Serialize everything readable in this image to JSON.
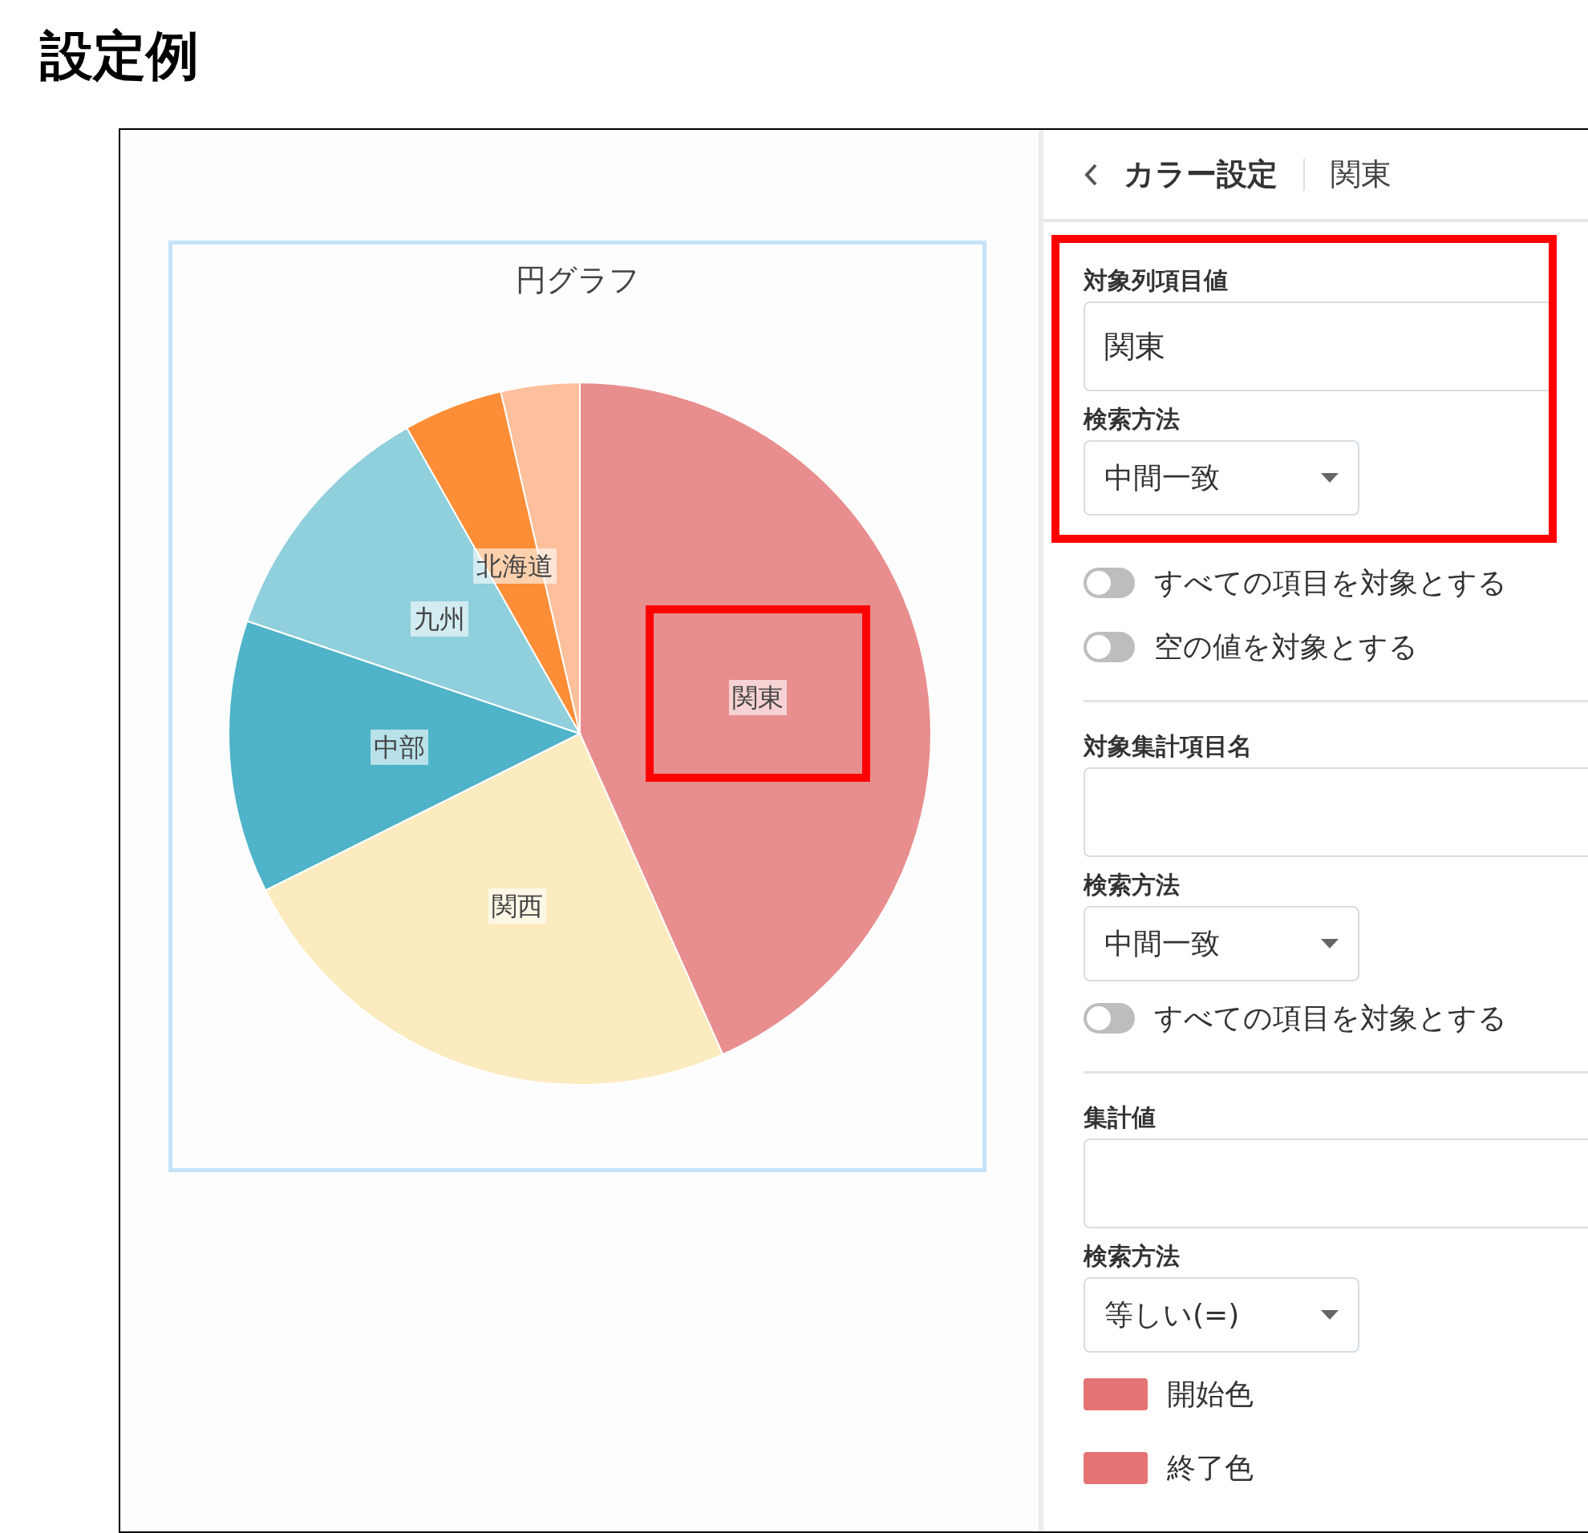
{
  "heading": "設定例",
  "chart": {
    "title": "円グラフ",
    "slices": [
      {
        "label": "関東",
        "color": "#e88e8e",
        "highlighted": true
      },
      {
        "label": "関西",
        "color": "#fbebbf",
        "highlighted": false
      },
      {
        "label": "中部",
        "color": "#4fb3c9",
        "highlighted": false
      },
      {
        "label": "九州",
        "color": "#90cfdc",
        "highlighted": false
      },
      {
        "label": "北海道",
        "color": "#fd8d36",
        "highlighted": false
      },
      {
        "color": "#fdbf9c"
      }
    ]
  },
  "panel": {
    "title": "カラー設定",
    "subtitle": "関東",
    "sections": [
      {
        "items": [
          {
            "kind": "text",
            "label": "対象列項目値",
            "value": "関東",
            "highlighted": true
          },
          {
            "kind": "select",
            "label": "検索方法",
            "value": "中間一致",
            "highlighted": true
          },
          {
            "kind": "toggle",
            "label": "すべての項目を対象とする",
            "on": false,
            "highlighted": false
          },
          {
            "kind": "toggle",
            "label": "空の値を対象とする",
            "on": false,
            "highlighted": false
          }
        ]
      },
      {
        "items": [
          {
            "kind": "text",
            "label": "対象集計項目名",
            "highlighted": false
          },
          {
            "kind": "select",
            "label": "検索方法",
            "value": "中間一致",
            "highlighted": false
          },
          {
            "kind": "toggle",
            "label": "すべての項目を対象とする",
            "on": false,
            "highlighted": false
          }
        ]
      },
      {
        "items": [
          {
            "kind": "text",
            "label": "集計値",
            "highlighted": false
          },
          {
            "kind": "select",
            "label": "検索方法",
            "value": "等しい(=)",
            "highlighted": false
          },
          {
            "kind": "color",
            "label": "開始色",
            "color": "#e57373",
            "highlighted": false
          },
          {
            "kind": "color",
            "label": "終了色",
            "color": "#e57373",
            "highlighted": false
          }
        ]
      }
    ]
  }
}
